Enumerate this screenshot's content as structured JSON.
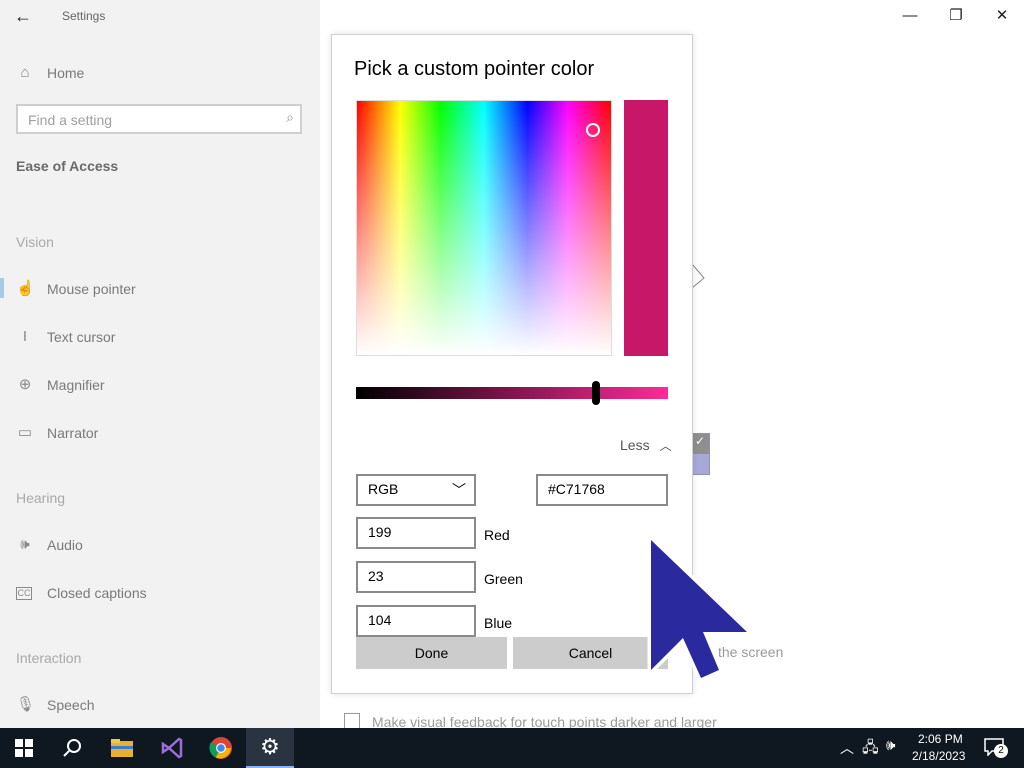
{
  "window": {
    "title": "Settings"
  },
  "sidebar": {
    "home": "Home",
    "search_placeholder": "Find a setting",
    "category": "Ease of Access",
    "sections": [
      {
        "header": "Vision",
        "items": [
          "Mouse pointer",
          "Text cursor",
          "Magnifier",
          "Narrator"
        ]
      },
      {
        "header": "Hearing",
        "items": [
          "Audio",
          "Closed captions"
        ]
      },
      {
        "header": "Interaction",
        "items": [
          "Speech"
        ]
      }
    ]
  },
  "background": {
    "partial_text": "the screen",
    "checkbox_label": "Make visual feedback for touch points darker and larger"
  },
  "dialog": {
    "title": "Pick a custom pointer color",
    "current_color": "#C71768",
    "less_label": "Less",
    "mode": "RGB",
    "hex_value": "#C71768",
    "red": {
      "value": "199",
      "label": "Red"
    },
    "green": {
      "value": "23",
      "label": "Green"
    },
    "blue": {
      "value": "104",
      "label": "Blue"
    },
    "done_label": "Done",
    "cancel_label": "Cancel",
    "brightness_fraction": 0.77
  },
  "taskbar": {
    "time": "2:06 PM",
    "date": "2/18/2023",
    "notification_count": "2"
  }
}
